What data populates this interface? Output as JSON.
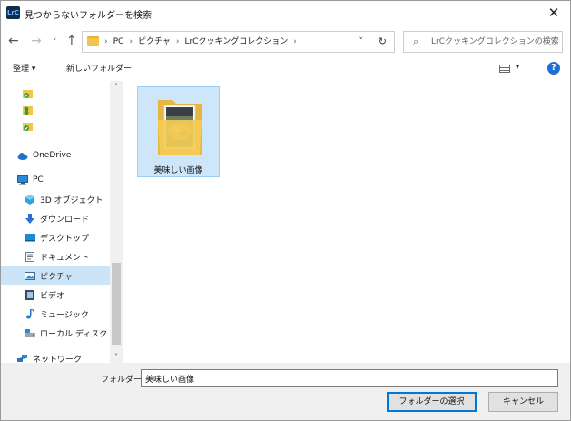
{
  "window": {
    "app_icon_text": "LrC",
    "title": "見つからないフォルダーを検索",
    "close_label": "✕"
  },
  "nav": {
    "back": "←",
    "forward": "→",
    "recent": "˅",
    "up": "↑"
  },
  "address": {
    "crumbs": [
      "PC",
      "ピクチャ",
      "LrCクッキングコレクション"
    ],
    "separator": "›",
    "dropdown": "˅",
    "refresh": "↻"
  },
  "search": {
    "icon": "⌕",
    "placeholder": "LrCクッキングコレクションの検索"
  },
  "toolbar": {
    "organize": "整理 ▾",
    "new_folder": "新しいフォルダー",
    "view_dropdown": "▾",
    "help": "?"
  },
  "sidebar": {
    "items": [
      {
        "label": "",
        "icon": "sync-folder-icon"
      },
      {
        "label": "",
        "icon": "sync-folder-icon"
      },
      {
        "label": "",
        "icon": "sync-folder-icon"
      },
      {
        "label": "OneDrive",
        "icon": "cloud-icon"
      },
      {
        "label": "PC",
        "icon": "pc-icon"
      },
      {
        "label": "3D オブジェクト",
        "icon": "3d-objects-icon"
      },
      {
        "label": "ダウンロード",
        "icon": "download-icon"
      },
      {
        "label": "デスクトップ",
        "icon": "desktop-icon"
      },
      {
        "label": "ドキュメント",
        "icon": "document-icon"
      },
      {
        "label": "ピクチャ",
        "icon": "pictures-icon",
        "selected": true
      },
      {
        "label": "ビデオ",
        "icon": "video-icon"
      },
      {
        "label": "ミュージック",
        "icon": "music-icon"
      },
      {
        "label": "ローカル ディスク (C",
        "icon": "disk-icon"
      },
      {
        "label": "ネットワーク",
        "icon": "network-icon"
      }
    ],
    "scroll_up": "˄",
    "scroll_down": "˅"
  },
  "content": {
    "items": [
      {
        "label": "美味しい画像",
        "icon": "photo-folder-icon"
      }
    ]
  },
  "footer": {
    "folder_label": "フォルダー:",
    "folder_value": "美味しい画像",
    "select_button": "フォルダーの選択",
    "cancel_button": "キャンセル"
  },
  "colors": {
    "selection": "#cce4f7",
    "accent": "#0078d7",
    "folder": "#f3c64a"
  }
}
